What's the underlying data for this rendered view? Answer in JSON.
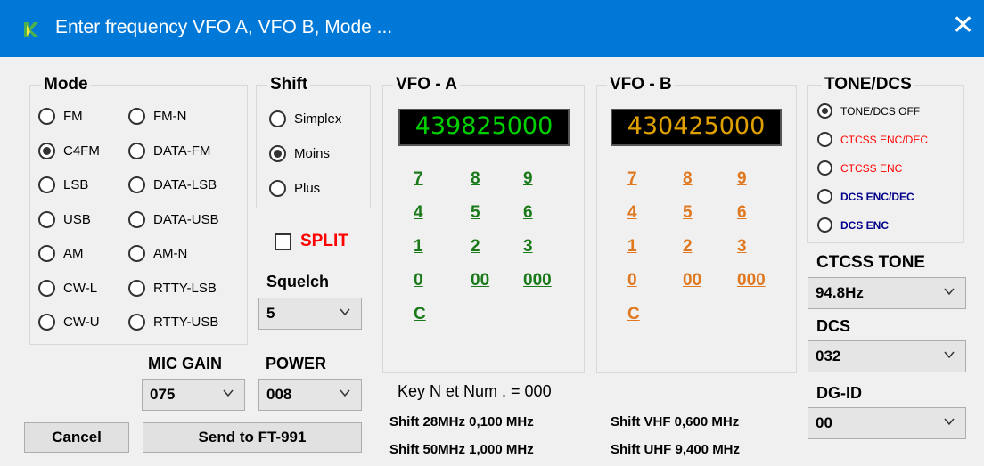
{
  "window": {
    "title": "Enter frequency VFO A, VFO B, Mode ...",
    "close_glyph": "✕"
  },
  "mode": {
    "label": "Mode",
    "options": [
      "FM",
      "FM-N",
      "C4FM",
      "DATA-FM",
      "LSB",
      "DATA-LSB",
      "USB",
      "DATA-USB",
      "AM",
      "AM-N",
      "CW-L",
      "RTTY-LSB",
      "CW-U",
      "RTTY-USB"
    ],
    "selected": "C4FM"
  },
  "shift": {
    "label": "Shift",
    "options": [
      "Simplex",
      "Moins",
      "Plus"
    ],
    "selected": "Moins"
  },
  "split": {
    "label": "SPLIT",
    "checked": false,
    "color": "#ff0000"
  },
  "squelch": {
    "label": "Squelch",
    "value": "5"
  },
  "mic_gain": {
    "label": "MIC GAIN",
    "value": "075"
  },
  "power": {
    "label": "POWER",
    "value": "008"
  },
  "vfo_a": {
    "label": "VFO - A",
    "frequency": "439825000",
    "keys": [
      "7",
      "8",
      "9",
      "4",
      "5",
      "6",
      "1",
      "2",
      "3",
      "0",
      "00",
      "000",
      "C"
    ],
    "color": "#1a7a1a"
  },
  "vfo_b": {
    "label": "VFO - B",
    "frequency": "430425000",
    "keys": [
      "7",
      "8",
      "9",
      "4",
      "5",
      "6",
      "1",
      "2",
      "3",
      "0",
      "00",
      "000",
      "C"
    ],
    "color": "#e07820"
  },
  "tone_dcs": {
    "label": "TONE/DCS",
    "options": [
      {
        "label": "TONE/DCS OFF",
        "color": "#000000"
      },
      {
        "label": "CTCSS ENC/DEC",
        "color": "#ff0000"
      },
      {
        "label": "CTCSS ENC",
        "color": "#ff0000"
      },
      {
        "label": "DCS ENC/DEC",
        "color": "#00008b"
      },
      {
        "label": "DCS ENC",
        "color": "#00008b"
      }
    ],
    "selected": "TONE/DCS OFF"
  },
  "ctcss_tone": {
    "label": "CTCSS TONE",
    "value": "94.8Hz"
  },
  "dcs": {
    "label": "DCS",
    "value": "032"
  },
  "dg_id": {
    "label": "DG-ID",
    "value": "00"
  },
  "key_info": {
    "text": "Key N  et Num . = 000",
    "color": "#1e6fd0"
  },
  "shifts": {
    "hf28": "Shift 28MHz 0,100 MHz",
    "hf50": "Shift 50MHz 1,000 MHz",
    "vhf": "Shift VHF 0,600 MHz",
    "uhf": "Shift UHF 9,400 MHz"
  },
  "buttons": {
    "cancel": "Cancel",
    "send": "Send to FT-991"
  }
}
